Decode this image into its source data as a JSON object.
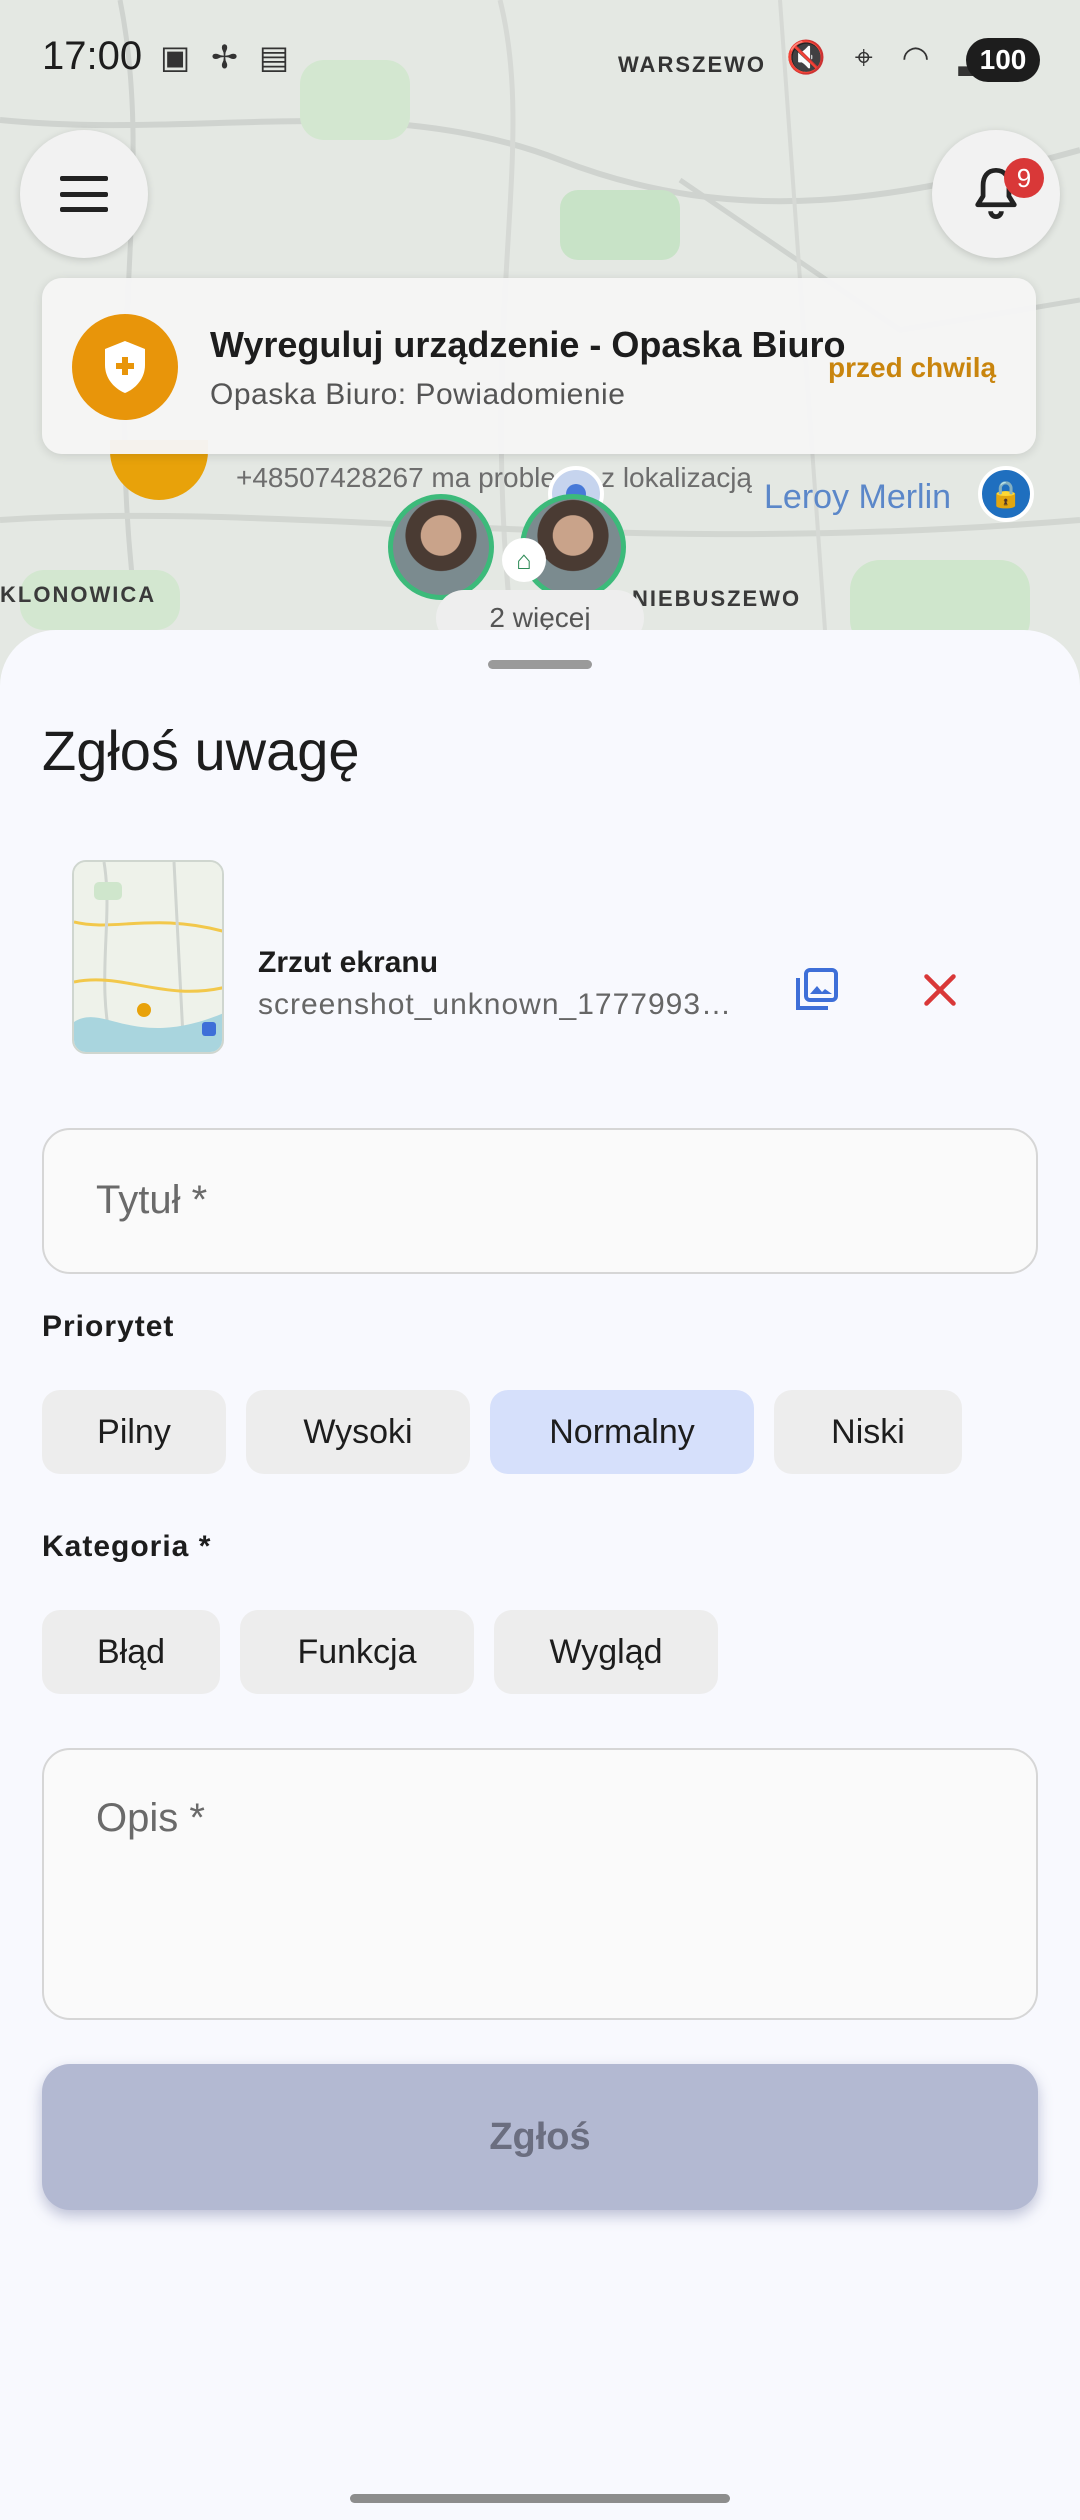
{
  "status_bar": {
    "time": "17:00",
    "left_icons": "▣ ✢ ▤",
    "place": "WARSZEWO",
    "right_icons": "🔇 ⌖ ◠ ▂",
    "battery": "100"
  },
  "map": {
    "districts": [
      "KLONOWICA",
      "NIEBUSZEWO"
    ],
    "shop_label": "Leroy Merlin",
    "phone_text": "+48507428267 ma problemy z lokalizacją",
    "more_label": "2 więcej"
  },
  "top_buttons": {
    "menu_icon": "menu-icon",
    "bell_icon": "bell-icon",
    "notification_count": "9"
  },
  "notification": {
    "title": "Wyreguluj urządzenie - Opaska Biuro",
    "subtitle": "Opaska Biuro: Powiadomienie",
    "time": "przed chwilą",
    "color": "#e8950a"
  },
  "sheet": {
    "title": "Zgłoś uwagę",
    "attachment": {
      "name": "Zrzut ekranu",
      "file": "screenshot_unknown_1777993049123.png"
    },
    "title_field_label": "Tytuł *",
    "priority_label": "Priorytet",
    "priorities": [
      "Pilny",
      "Wysoki",
      "Normalny",
      "Niski"
    ],
    "selected_priority": "Normalny",
    "category_label": "Kategoria *",
    "categories": [
      "Błąd",
      "Funkcja",
      "Wygląd"
    ],
    "description_label": "Opis *",
    "submit_label": "Zgłoś",
    "colors": {
      "accent": "#3e6fd8",
      "danger": "#d93838",
      "selected_chip": "#d6e0fb",
      "submit_disabled": "#b3b9d2"
    }
  }
}
